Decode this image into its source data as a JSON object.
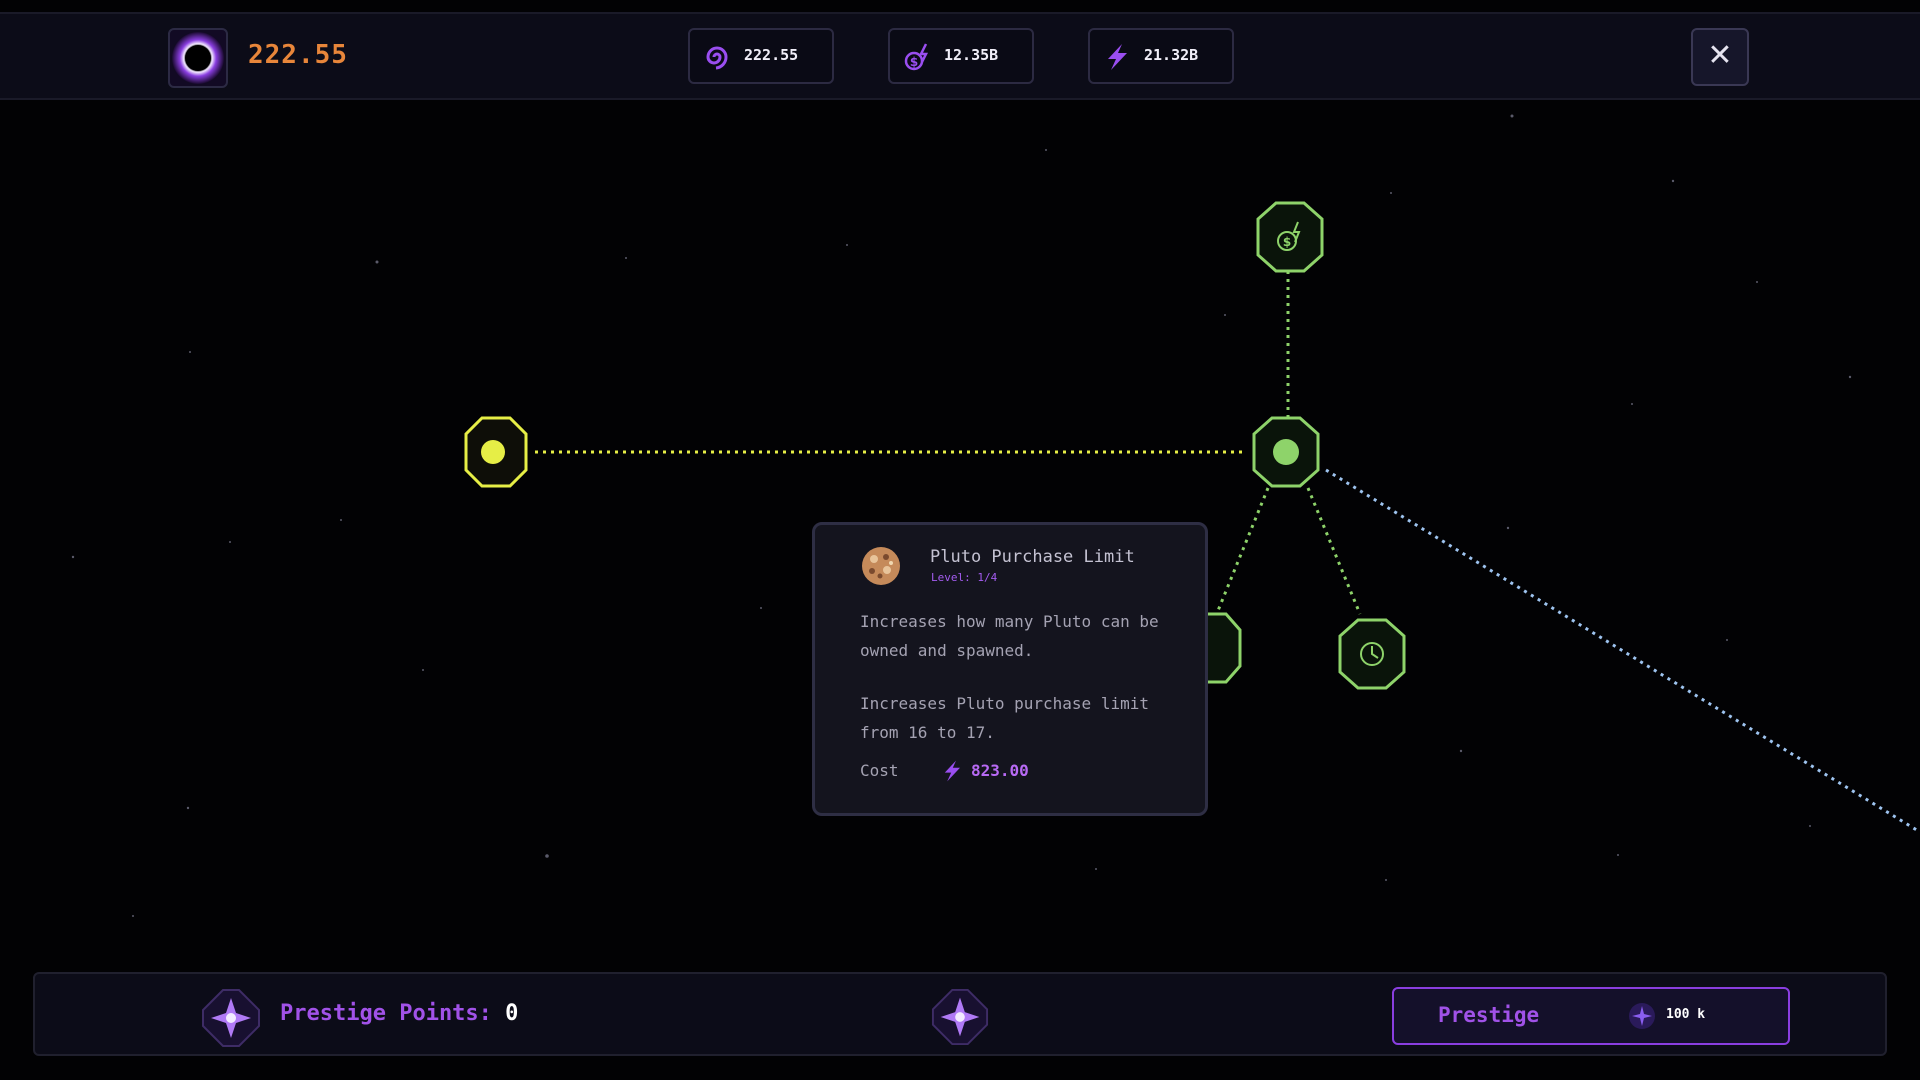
{
  "header": {
    "main_value": "222.55",
    "currencies": [
      {
        "icon": "spiral-galaxy-icon",
        "value": "222.55"
      },
      {
        "icon": "money-sparkle-icon",
        "value": "12.35B"
      },
      {
        "icon": "lightning-bolt-icon",
        "value": "21.32B"
      }
    ],
    "close_icon": "close-icon"
  },
  "tooltip": {
    "title": "Pluto Purchase Limit",
    "level": "Level: 1/4",
    "description": "Increases how many Pluto can be owned and spawned.",
    "effect": "Increases Pluto purchase limit from 16 to 17.",
    "cost_label": "Cost",
    "cost_value": "823.00"
  },
  "footer": {
    "prestige_points_label": "Prestige Points:",
    "prestige_points_value": "0",
    "prestige_button_label": "Prestige",
    "prestige_cost": "100 k"
  },
  "colors": {
    "accent_purple": "#a152e8",
    "node_yellow": "#e6ee46",
    "node_green": "#8ed36a",
    "main_value_orange": "#e8863a"
  }
}
